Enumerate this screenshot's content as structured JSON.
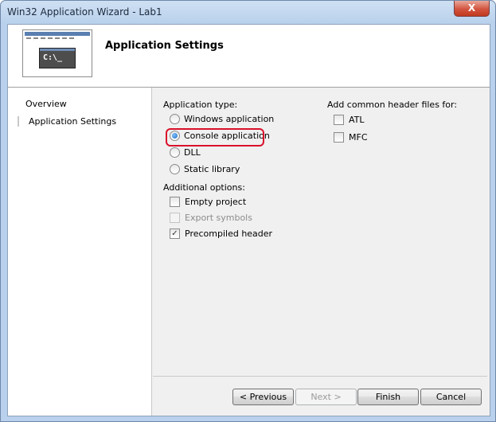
{
  "window": {
    "title": "Win32 Application Wizard - Lab1",
    "close_glyph": "X"
  },
  "banner": {
    "title": "Application Settings",
    "console_text": "C:\\_"
  },
  "nav": {
    "items": [
      {
        "label": "Overview"
      },
      {
        "label": "Application Settings",
        "selected": true
      }
    ]
  },
  "application_type": {
    "label": "Application type:",
    "options": [
      {
        "label": "Windows application",
        "checked": false
      },
      {
        "label": "Console application",
        "checked": true
      },
      {
        "label": "DLL",
        "checked": false
      },
      {
        "label": "Static library",
        "checked": false
      }
    ]
  },
  "additional_options": {
    "label": "Additional options:",
    "options": [
      {
        "label": "Empty project",
        "checked": false,
        "enabled": true
      },
      {
        "label": "Export symbols",
        "checked": false,
        "enabled": false
      },
      {
        "label": "Precompiled header",
        "checked": true,
        "enabled": true
      }
    ]
  },
  "header_files": {
    "label": "Add common header files for:",
    "options": [
      {
        "label": "ATL",
        "checked": false
      },
      {
        "label": "MFC",
        "checked": false
      }
    ]
  },
  "check_glyph": "✓",
  "buttons": {
    "previous": "< Previous",
    "next": "Next >",
    "finish": "Finish",
    "cancel": "Cancel"
  },
  "colors": {
    "highlight": "#d9112b",
    "title_bar": "#b9d1ec"
  }
}
